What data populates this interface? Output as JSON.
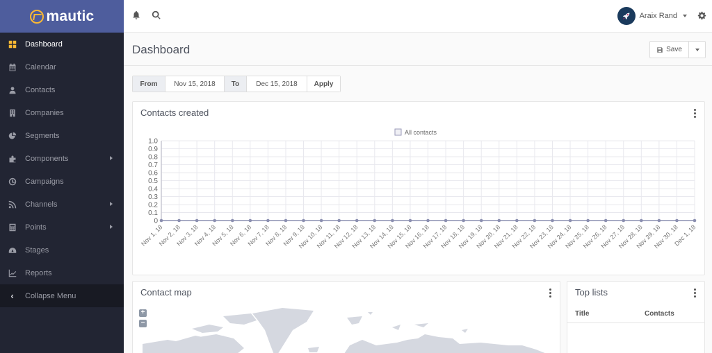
{
  "brand": {
    "name": "mautic",
    "accent": "#4e5d9d",
    "logo_color": "#fdb933"
  },
  "sidebar": {
    "items": [
      {
        "label": "Dashboard",
        "icon": "dashboard-icon",
        "active": true,
        "submenu": false
      },
      {
        "label": "Calendar",
        "icon": "calendar-icon",
        "active": false,
        "submenu": false
      },
      {
        "label": "Contacts",
        "icon": "user-icon",
        "active": false,
        "submenu": false
      },
      {
        "label": "Companies",
        "icon": "building-icon",
        "active": false,
        "submenu": false
      },
      {
        "label": "Segments",
        "icon": "pie-chart-icon",
        "active": false,
        "submenu": false
      },
      {
        "label": "Components",
        "icon": "puzzle-icon",
        "active": false,
        "submenu": true
      },
      {
        "label": "Campaigns",
        "icon": "clock-icon",
        "active": false,
        "submenu": false
      },
      {
        "label": "Channels",
        "icon": "rss-icon",
        "active": false,
        "submenu": true
      },
      {
        "label": "Points",
        "icon": "calculator-icon",
        "active": false,
        "submenu": true
      },
      {
        "label": "Stages",
        "icon": "tachometer-icon",
        "active": false,
        "submenu": false
      },
      {
        "label": "Reports",
        "icon": "line-chart-icon",
        "active": false,
        "submenu": false
      }
    ],
    "collapse_label": "Collapse Menu"
  },
  "topbar": {
    "user_name": "Araix Rand"
  },
  "page": {
    "title": "Dashboard",
    "save_label": "Save"
  },
  "date_filter": {
    "from_label": "From",
    "from_value": "Nov 15, 2018",
    "to_label": "To",
    "to_value": "Dec 15, 2018",
    "apply_label": "Apply"
  },
  "widgets": {
    "contacts_created": {
      "title": "Contacts created"
    },
    "contact_map": {
      "title": "Contact map",
      "zoom_in": "+",
      "zoom_out": "−"
    },
    "top_lists": {
      "title": "Top lists",
      "columns": [
        "Title",
        "Contacts"
      ],
      "rows": []
    }
  },
  "chart_data": {
    "type": "line",
    "title": "Contacts created",
    "legend": [
      "All contacts"
    ],
    "legend_position": "top-center",
    "xlabel": "",
    "ylabel": "",
    "ylim": [
      0,
      1.0
    ],
    "yticks": [
      "1.0",
      "0.9",
      "0.8",
      "0.7",
      "0.6",
      "0.5",
      "0.4",
      "0.3",
      "0.2",
      "0.1",
      "0"
    ],
    "grid": true,
    "categories": [
      "Nov 1, 18",
      "Nov 2, 18",
      "Nov 3, 18",
      "Nov 4, 18",
      "Nov 5, 18",
      "Nov 6, 18",
      "Nov 7, 18",
      "Nov 8, 18",
      "Nov 9, 18",
      "Nov 10, 18",
      "Nov 11, 18",
      "Nov 12, 18",
      "Nov 13, 18",
      "Nov 14, 18",
      "Nov 15, 18",
      "Nov 16, 18",
      "Nov 17, 18",
      "Nov 18, 18",
      "Nov 19, 18",
      "Nov 20, 18",
      "Nov 21, 18",
      "Nov 22, 18",
      "Nov 23, 18",
      "Nov 24, 18",
      "Nov 25, 18",
      "Nov 26, 18",
      "Nov 27, 18",
      "Nov 28, 18",
      "Nov 29, 18",
      "Nov 30, 18",
      "Dec 1, 18"
    ],
    "series": [
      {
        "name": "All contacts",
        "color": "#8b8fb0",
        "values": [
          0,
          0,
          0,
          0,
          0,
          0,
          0,
          0,
          0,
          0,
          0,
          0,
          0,
          0,
          0,
          0,
          0,
          0,
          0,
          0,
          0,
          0,
          0,
          0,
          0,
          0,
          0,
          0,
          0,
          0,
          0
        ]
      }
    ]
  }
}
